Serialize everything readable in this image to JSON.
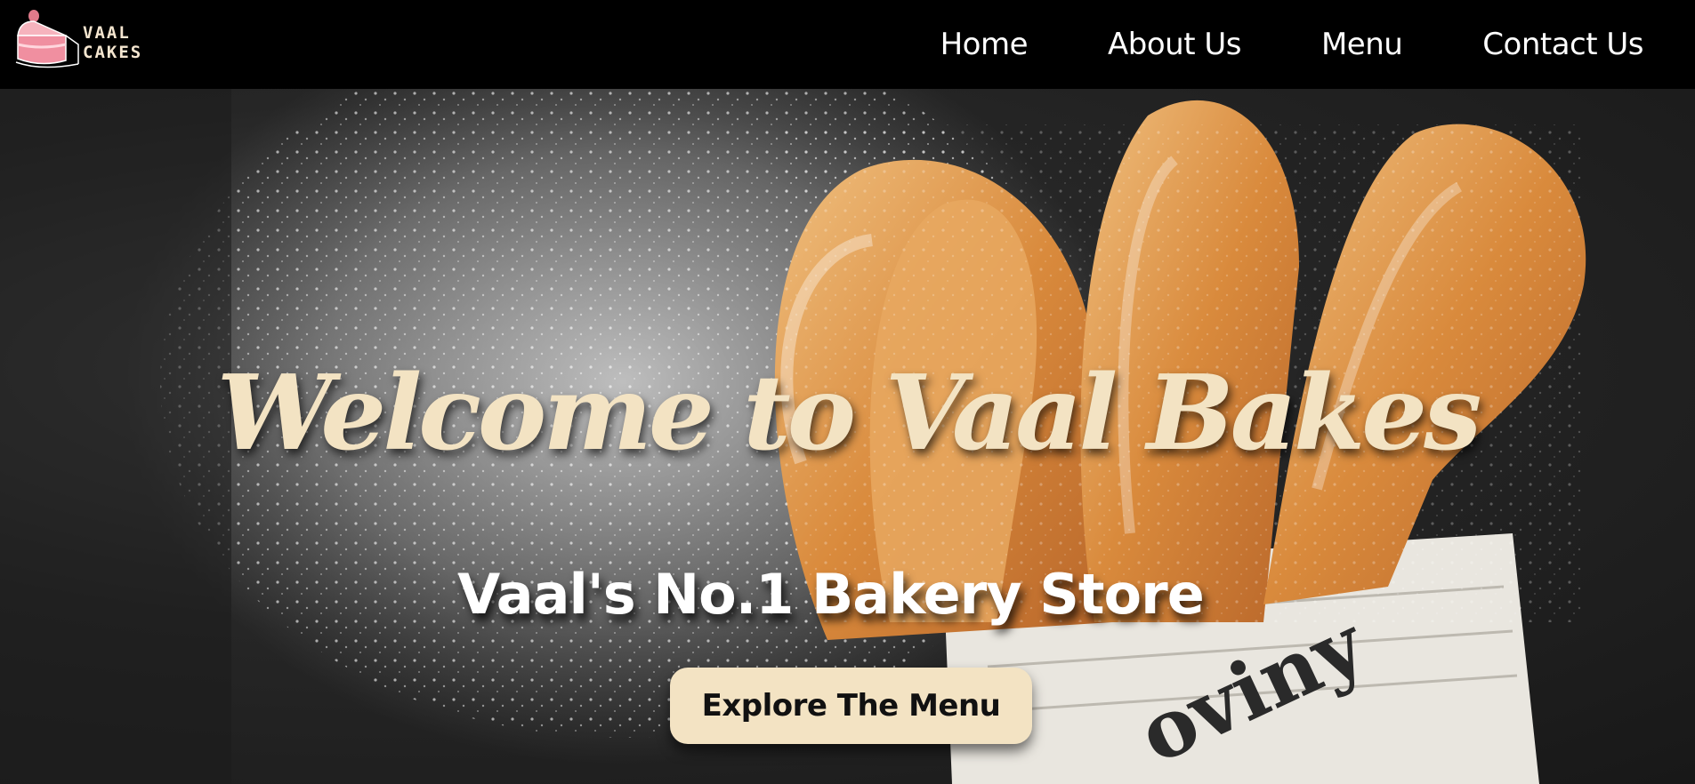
{
  "brand": {
    "logo_line1": "VAAL",
    "logo_line2": "CAKES"
  },
  "nav": {
    "items": [
      "Home",
      "About Us",
      "Menu",
      "Contact Us"
    ]
  },
  "hero": {
    "title": "Welcome to Vaal Bakes",
    "subtitle": "Vaal's No.1 Bakery Store",
    "cta_label": "Explore The Menu",
    "newspaper_text": "oviny"
  },
  "colors": {
    "accent": "#f3e3c3",
    "navbar_bg": "#000000",
    "logo_pink": "#f08fa0"
  },
  "icons": {
    "logo": "cake-slice-icon"
  }
}
